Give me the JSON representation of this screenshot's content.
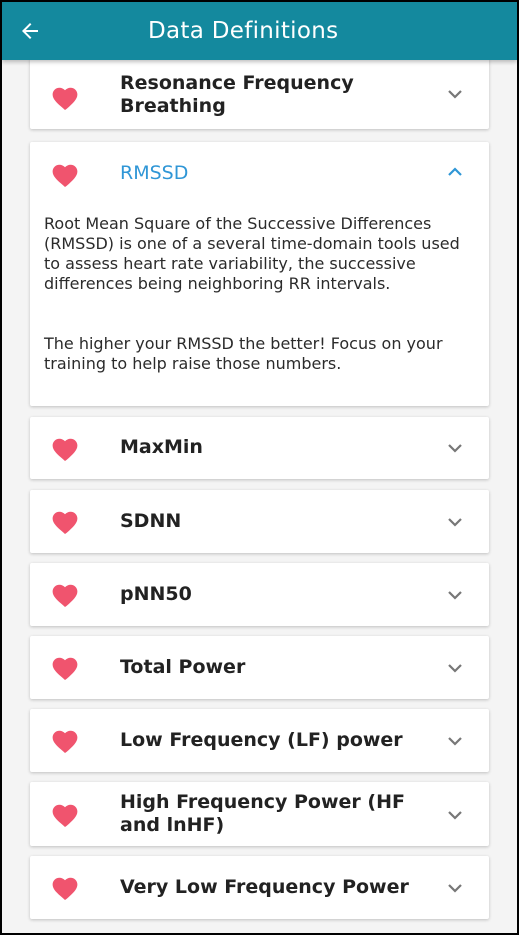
{
  "header": {
    "title": "Data Definitions",
    "back_icon": "arrow-left-icon",
    "background": "#14899e"
  },
  "colors": {
    "heart": "#f0546e",
    "active_title": "#2f96d6",
    "chevron": "#777777"
  },
  "items": [
    {
      "title": "Resonance Frequency Breathing",
      "expanded": false
    },
    {
      "title": "RMSSD",
      "expanded": true,
      "description_1": "Root Mean Square of the Successive Differences (RMSSD) is one of a several time-domain tools used to assess heart rate variability, the successive differences being neighboring RR intervals.",
      "description_2": "The higher your RMSSD the better! Focus on your training to help raise those numbers."
    },
    {
      "title": "MaxMin",
      "expanded": false
    },
    {
      "title": "SDNN",
      "expanded": false
    },
    {
      "title": "pNN50",
      "expanded": false
    },
    {
      "title": "Total Power",
      "expanded": false
    },
    {
      "title": "Low Frequency (LF) power",
      "expanded": false
    },
    {
      "title": "High Frequency Power (HF and lnHF)",
      "expanded": false
    },
    {
      "title": "Very Low Frequency Power",
      "expanded": false
    }
  ]
}
